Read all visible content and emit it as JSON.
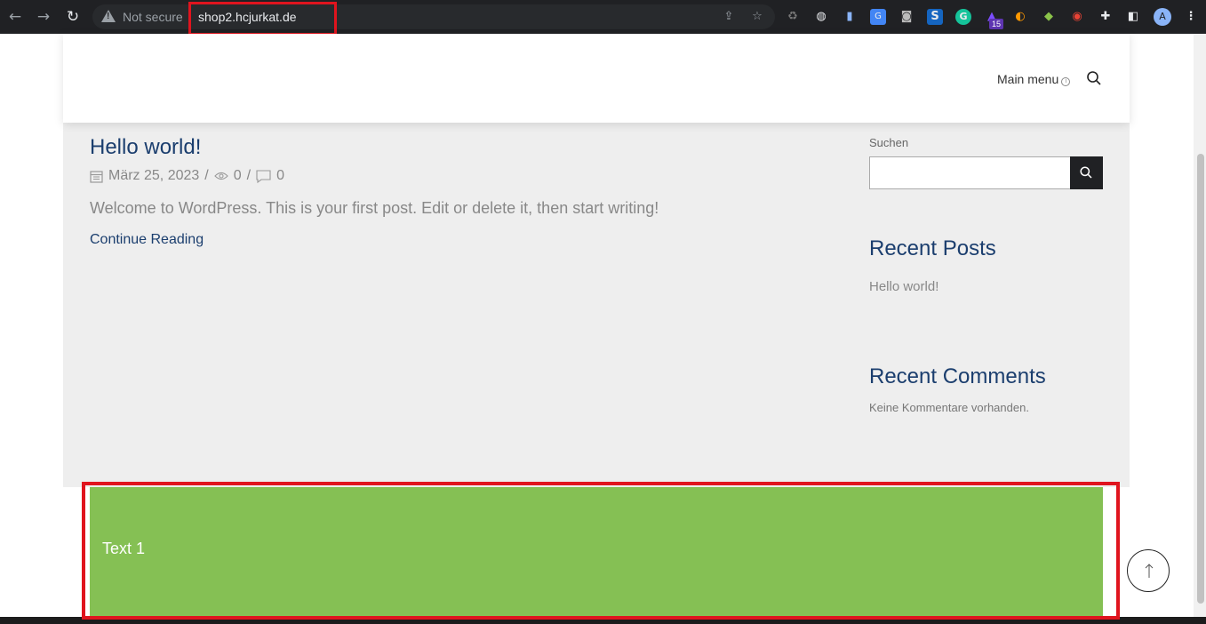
{
  "browser": {
    "security_label": "Not secure",
    "url": "shop2.hcjurkat.de",
    "extension_badge": "15",
    "profile_initial": "A"
  },
  "header": {
    "menu_label": "Main menu"
  },
  "post": {
    "title": "Hello world!",
    "date": "März 25, 2023",
    "separator": "/",
    "views": "0",
    "comments": "0",
    "excerpt": "Welcome to WordPress. This is your first post. Edit or delete it, then start writing!",
    "continue_label": "Continue Reading"
  },
  "sidebar": {
    "search_label": "Suchen",
    "recent_posts_heading": "Recent Posts",
    "recent_posts": [
      "Hello world!"
    ],
    "recent_comments_heading": "Recent Comments",
    "no_comments": "Keine Kommentare vorhanden."
  },
  "block": {
    "text": "Text 1"
  },
  "colors": {
    "accent": "#1b3e6e",
    "block_green": "#85c054",
    "highlight_red": "#e0141e"
  }
}
